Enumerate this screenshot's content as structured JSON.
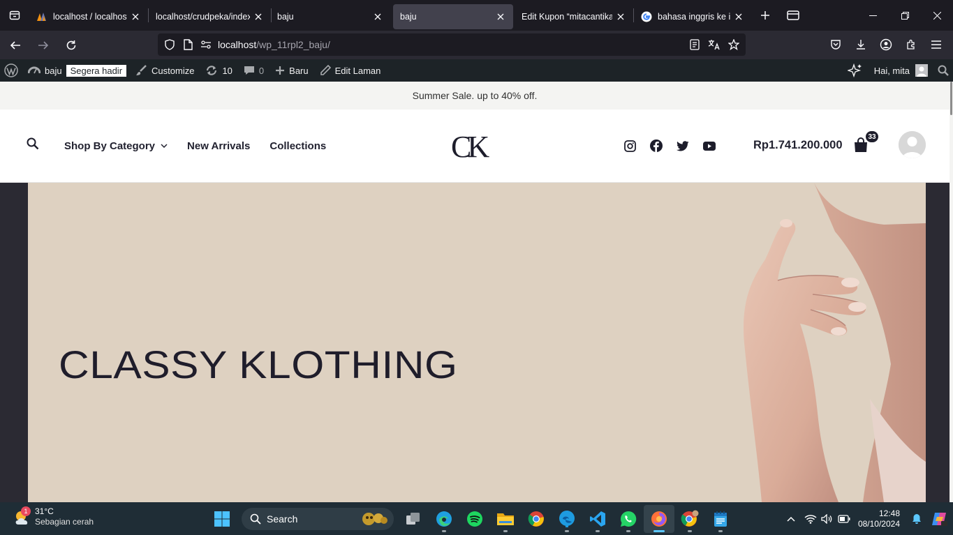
{
  "browser": {
    "tabs": [
      {
        "title": "localhost / localhost /",
        "favicon": "phpmyadmin-icon",
        "active": false
      },
      {
        "title": "localhost/crudpeka/index.p",
        "favicon": "none",
        "active": false
      },
      {
        "title": "baju",
        "favicon": "none",
        "active": false
      },
      {
        "title": "baju",
        "favicon": "none",
        "active": true
      },
      {
        "title": "Edit Kupon “mitacantikaso",
        "favicon": "none",
        "active": false
      },
      {
        "title": "bahasa inggris ke indon",
        "favicon": "google-icon",
        "active": false
      }
    ],
    "url_host": "localhost",
    "url_path": "/wp_11rpl2_baju/"
  },
  "wp_admin_bar": {
    "site_name": "baju",
    "coming_soon": "Segera hadir",
    "customize": "Customize",
    "updates": "10",
    "comments": "0",
    "new": "Baru",
    "edit_page": "Edit Laman",
    "greeting": "Hai, mita"
  },
  "site": {
    "announcement": "Summer Sale. up to 40% off.",
    "nav": {
      "shop": "Shop By Category",
      "new_arrivals": "New Arrivals",
      "collections": "Collections"
    },
    "logo": "CK",
    "cart_total": "Rp1.741.200.000",
    "cart_count": "33",
    "hero_title": "CLASSY KLOTHING",
    "colors": {
      "hero_bg": "#ded1c1",
      "text_dark": "#1f1d2b"
    }
  },
  "taskbar": {
    "weather_temp": "31°C",
    "weather_cond": "Sebagian cerah",
    "weather_badge": "1",
    "search": "Search",
    "time": "12:48",
    "date": "08/10/2024"
  }
}
